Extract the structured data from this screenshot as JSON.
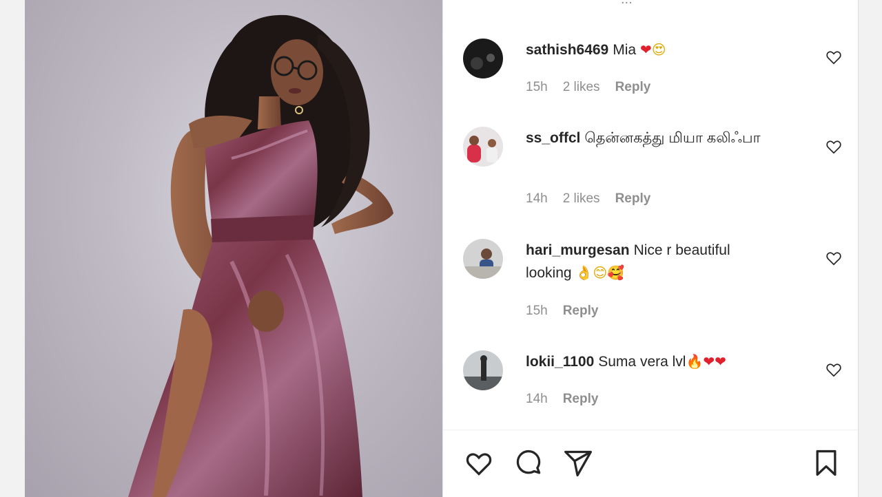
{
  "post": {
    "image_alt": "Woman with curly hair and glasses posing in a shimmering maroon one-shoulder gown against a grey backdrop"
  },
  "comments": [
    {
      "username": "sathish6469",
      "text": "Mia",
      "emojis": [
        "heart",
        "heart-eyes"
      ],
      "time": "15h",
      "likes": "2 likes",
      "reply": "Reply"
    },
    {
      "username": "ss_offcl",
      "text": "தென்னகத்து மியா கலிஃபா",
      "emojis": [],
      "time": "14h",
      "likes": "2 likes",
      "reply": "Reply"
    },
    {
      "username": "hari_murgesan",
      "text": "Nice r beautiful looking",
      "emojis": [
        "ok-hand",
        "smile",
        "smiling-hearts"
      ],
      "time": "15h",
      "likes": "",
      "reply": "Reply"
    },
    {
      "username": "lokii_1100",
      "text": "Suma vera lvl",
      "emojis": [
        "fire",
        "heart",
        "heart"
      ],
      "time": "14h",
      "likes": "",
      "reply": "Reply"
    }
  ],
  "actions": [
    "like-icon",
    "comment-icon",
    "share-icon",
    "save-icon"
  ],
  "colors": {
    "text": "#262626",
    "muted": "#8e8e8e",
    "heart": "#e0202c",
    "dress": "#7a3548"
  }
}
